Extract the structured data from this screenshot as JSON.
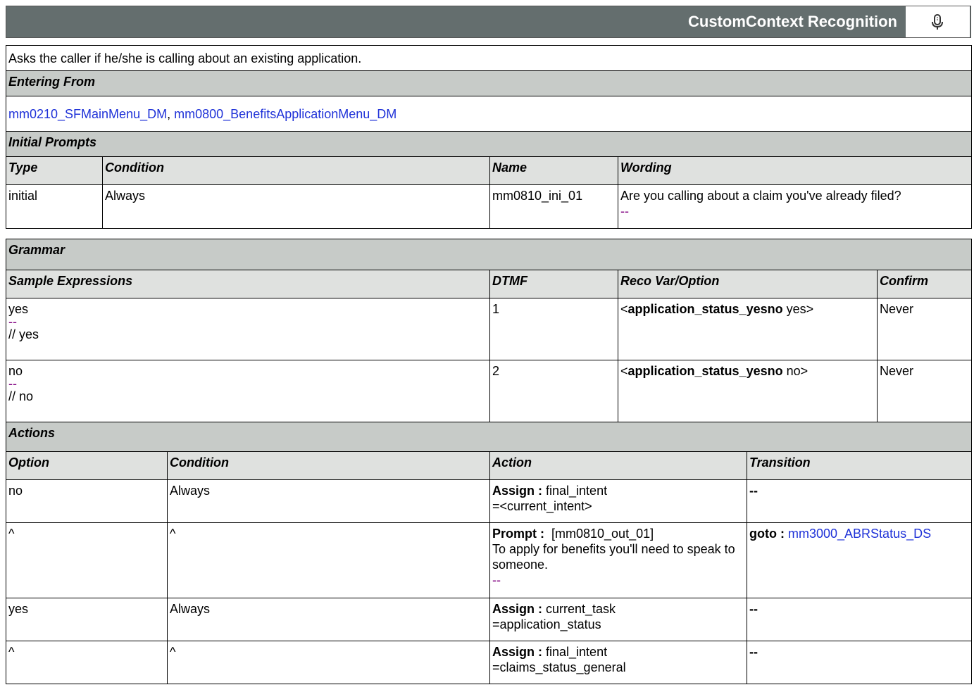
{
  "header": {
    "title": "CustomContext Recognition",
    "icon": "microphone-icon"
  },
  "description": "Asks the caller if he/she is calling about an existing application.",
  "entering_from": {
    "label": "Entering From",
    "links": [
      "mm0210_SFMainMenu_DM",
      "mm0800_BenefitsApplicationMenu_DM"
    ],
    "separator": ","
  },
  "initial_prompts": {
    "label": "Initial Prompts",
    "columns": [
      "Type",
      "Condition",
      "Name",
      "Wording"
    ],
    "rows": [
      {
        "type": "initial",
        "condition": "Always",
        "name": "mm0810_ini_01",
        "wording": "Are you calling about a claim you've already filed?",
        "dash": "--"
      }
    ]
  },
  "grammar": {
    "label": "Grammar",
    "columns": [
      "Sample Expressions",
      "DTMF",
      "Reco Var/Option",
      "Confirm"
    ],
    "rows": [
      {
        "expr": "yes",
        "dash": "--",
        "comment": "// yes",
        "dtmf": "1",
        "var_open": "<",
        "var": "application_status_yesno",
        "var_value": " yes>",
        "confirm": "Never"
      },
      {
        "expr": "no",
        "dash": "--",
        "comment": "// no",
        "dtmf": "2",
        "var_open": "<",
        "var": "application_status_yesno",
        "var_value": " no>",
        "confirm": "Never"
      }
    ]
  },
  "actions": {
    "label": "Actions",
    "columns": [
      "Option",
      "Condition",
      "Action",
      "Transition"
    ],
    "rows": [
      {
        "option": "no",
        "condition": "Always",
        "kind": "Assign :",
        "line1": " final_intent",
        "line2": "=<current_intent>",
        "transition": "--"
      },
      {
        "option": "^",
        "condition": "^",
        "kind": "Prompt :",
        "line1": "  [mm0810_out_01]",
        "line2": "To apply for benefits you'll need to speak to someone.",
        "dash": "--",
        "goto_label": "goto :",
        "goto_target": "mm3000_ABRStatus_DS"
      },
      {
        "option": "yes",
        "condition": "Always",
        "kind": "Assign :",
        "line1": " current_task",
        "line2": "=application_status",
        "transition": "--"
      },
      {
        "option": "^",
        "condition": "^",
        "kind": "Assign :",
        "line1": " final_intent",
        "line2": "=claims_status_general",
        "transition": "--"
      }
    ]
  }
}
